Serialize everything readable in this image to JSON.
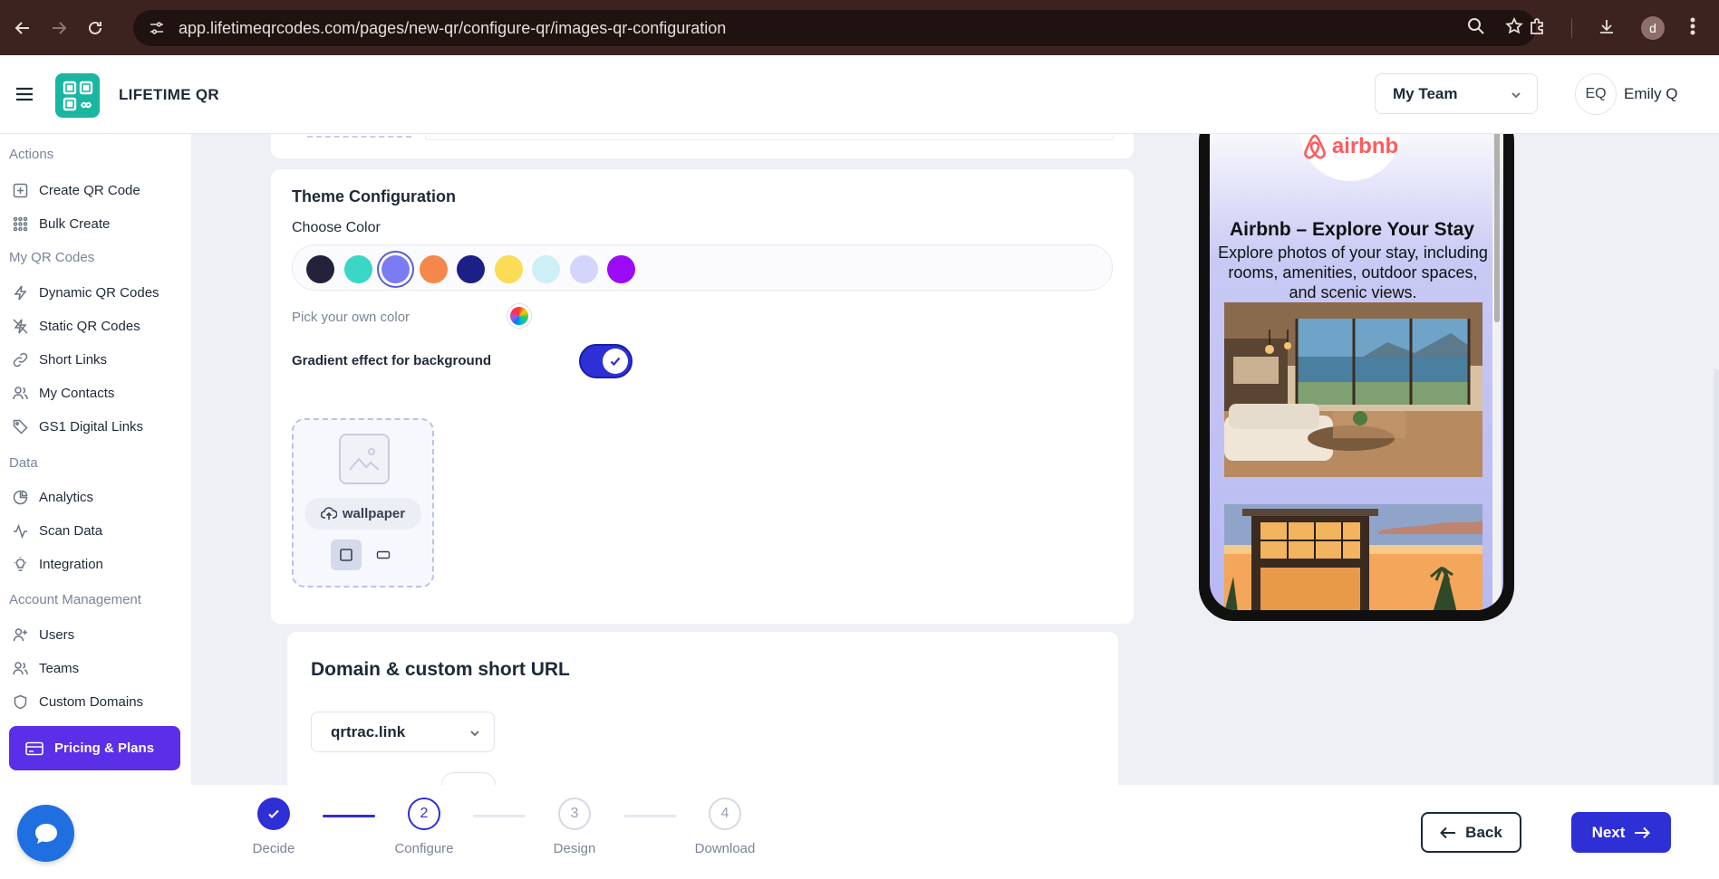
{
  "browser": {
    "url": "app.lifetimeqrcodes.com/pages/new-qr/configure-qr/images-qr-configuration",
    "profile_initial": "d"
  },
  "header": {
    "brand": "LIFETIME QR",
    "team_select": "My Team",
    "user_initials": "EQ",
    "user_name": "Emily Q"
  },
  "sidebar": {
    "sections": {
      "actions": "Actions",
      "my_qr_codes": "My QR Codes",
      "data": "Data",
      "account": "Account Management"
    },
    "items": {
      "create_qr": "Create QR Code",
      "bulk_create": "Bulk Create",
      "dynamic_qr": "Dynamic QR Codes",
      "static_qr": "Static QR Codes",
      "short_links": "Short Links",
      "my_contacts": "My Contacts",
      "gs1": "GS1 Digital Links",
      "analytics": "Analytics",
      "scan_data": "Scan Data",
      "integration": "Integration",
      "users": "Users",
      "teams": "Teams",
      "custom_domains": "Custom Domains"
    },
    "pricing": "Pricing & Plans"
  },
  "theme": {
    "title": "Theme Configuration",
    "choose_color": "Choose Color",
    "colors": [
      "#23223a",
      "#3ad6c6",
      "#7b7cf2",
      "#f5874a",
      "#1c1f86",
      "#fadc55",
      "#cdeff5",
      "#d3d6fa",
      "#9b0bf5"
    ],
    "selected_color_index": 2,
    "pick_own_color": "Pick your own color",
    "gradient_label": "Gradient effect for background",
    "gradient_enabled": true,
    "wallpaper_label": "wallpaper"
  },
  "domain": {
    "title": "Domain & custom short URL",
    "selected_domain": "qrtrac.link"
  },
  "preview": {
    "brand_logo_text": "airbnb",
    "title": "Airbnb – Explore Your Stay",
    "description": "Explore photos of your stay, including rooms, amenities, outdoor spaces, and scenic views."
  },
  "stepper": {
    "steps": [
      {
        "number": "1",
        "label": "Decide",
        "state": "done"
      },
      {
        "number": "2",
        "label": "Configure",
        "state": "current"
      },
      {
        "number": "3",
        "label": "Design",
        "state": "upcoming"
      },
      {
        "number": "4",
        "label": "Download",
        "state": "upcoming"
      }
    ],
    "back": "Back",
    "next": "Next"
  }
}
